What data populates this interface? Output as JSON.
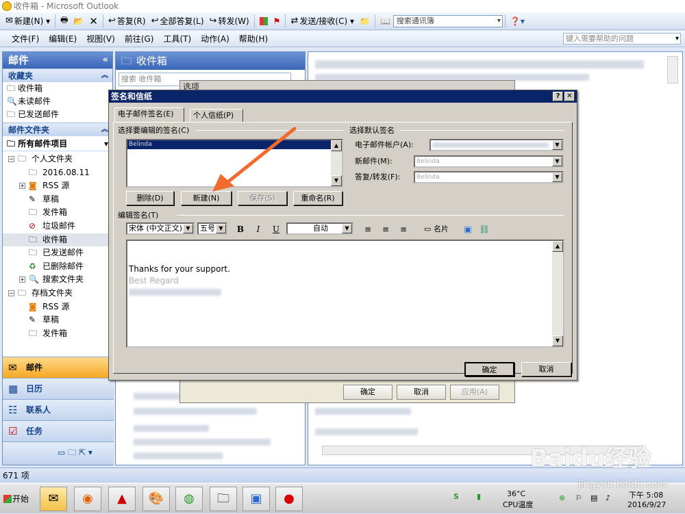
{
  "window": {
    "title": "收件箱 - Microsoft Outlook"
  },
  "toolbar": {
    "new_label": "新建(N)",
    "reply_label": "答复(R)",
    "reply_all_label": "全部答复(L)",
    "forward_label": "转发(W)",
    "send_receive_label": "发送/接收(C)",
    "address_search_placeholder": "搜索通讯簿"
  },
  "menu": {
    "items": [
      "文件(F)",
      "编辑(E)",
      "视图(V)",
      "前往(G)",
      "工具(T)",
      "动作(A)",
      "帮助(H)"
    ],
    "help_placeholder": "键入需要帮助的问题"
  },
  "nav": {
    "title": "邮件",
    "favorites_title": "收藏夹",
    "favorites": [
      "收件箱",
      "未读邮件",
      "已发送邮件"
    ],
    "mail_folders_title": "邮件文件夹",
    "all_items": "所有邮件项目",
    "tree": [
      "个人文件夹",
      "2016.08.11",
      "RSS 源",
      "草稿",
      "发件箱",
      "垃圾邮件",
      "收件箱",
      "已发送邮件",
      "已删除邮件",
      "搜索文件夹",
      "存档文件夹",
      "RSS 源",
      "草稿",
      "发件箱"
    ],
    "buttons": [
      "邮件",
      "日历",
      "联系人",
      "任务"
    ]
  },
  "folder_pane": {
    "title": "收件箱",
    "search_placeholder": "搜索 收件箱"
  },
  "options_dialog": {
    "title": "选项",
    "ok": "确定",
    "cancel": "取消",
    "apply": "应用(A)"
  },
  "signature_dialog": {
    "title": "签名和信纸",
    "tab_email_signature": "电子邮件签名(E)",
    "tab_stationery": "个人信纸(P)",
    "select_label": "选择要编辑的签名(C)",
    "signature_name": "Belinda",
    "delete": "删除(D)",
    "new": "新建(N)",
    "save": "保存(S)",
    "rename": "重命名(R)",
    "default_label": "选择默认签名",
    "account_label": "电子邮件帐户(A):",
    "new_messages_label": "新邮件(M):",
    "replies_label": "答复/转发(F):",
    "new_messages_value": "Belinda",
    "replies_value": "Belinda",
    "edit_label": "编辑签名(T)",
    "font": "宋体 (中文正文)",
    "size": "五号",
    "color": "自动",
    "card_label": "名片",
    "body_lines": [
      "Thanks for your support.",
      "Best Regard"
    ],
    "ok": "确定",
    "cancel": "取消"
  },
  "status": {
    "count": "671 项"
  },
  "taskbar": {
    "start": "开始",
    "temperature": "36°C",
    "cpu_label": "CPU温度",
    "time": "下午 5:08",
    "date": "2016/9/27"
  },
  "watermark": {
    "brand": "Baidu经验",
    "url": "jingyan.baidu.com"
  }
}
